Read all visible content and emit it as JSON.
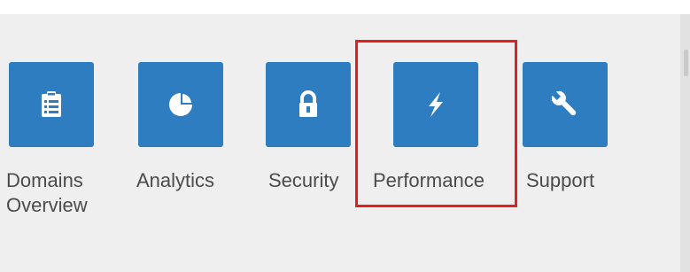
{
  "nav": {
    "items": [
      {
        "id": "domains-overview",
        "label_line1": "Domains",
        "label_line2": "Overview",
        "icon": "clipboard-list-icon"
      },
      {
        "id": "analytics",
        "label": "Analytics",
        "icon": "pie-chart-icon"
      },
      {
        "id": "security",
        "label": "Security",
        "icon": "lock-icon"
      },
      {
        "id": "performance",
        "label": "Performance",
        "icon": "lightning-bolt-icon"
      },
      {
        "id": "support",
        "label": "Support",
        "icon": "wrench-icon"
      }
    ],
    "highlighted": "performance"
  },
  "colors": {
    "tile": "#2f7dc1",
    "label": "#4b4b4b",
    "highlight": "#e51d1d",
    "panel": "#efefef"
  }
}
